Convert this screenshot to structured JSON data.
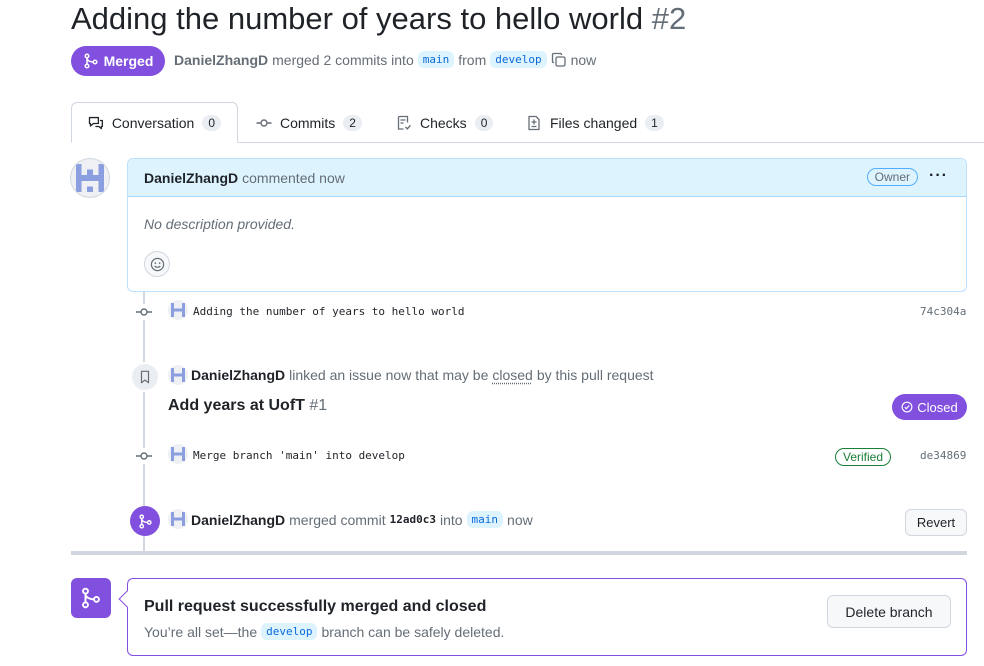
{
  "pr": {
    "title": "Adding the number of years to hello world",
    "number": "#2",
    "status": "Merged",
    "author": "DanielZhangD",
    "merged_text": "merged 2 commits into",
    "base_branch": "main",
    "from_text": "from",
    "head_branch": "develop",
    "time": "now"
  },
  "tabs": [
    {
      "label": "Conversation",
      "count": "0"
    },
    {
      "label": "Commits",
      "count": "2"
    },
    {
      "label": "Checks",
      "count": "0"
    },
    {
      "label": "Files changed",
      "count": "1"
    }
  ],
  "comment": {
    "author": "DanielZhangD",
    "action": "commented now",
    "role": "Owner",
    "body": "No description provided."
  },
  "timeline": {
    "commit1": {
      "message": "Adding the number of years to hello world",
      "sha": "74c304a"
    },
    "linked": {
      "author": "DanielZhangD",
      "text_pre": "linked an issue now that may be",
      "text_closed": "closed",
      "text_post": "by this pull request",
      "issue_title": "Add years at UofT",
      "issue_number": "#1",
      "issue_status": "Closed"
    },
    "commit2": {
      "message": "Merge branch 'main' into develop",
      "verified": "Verified",
      "sha": "de34869"
    },
    "merge_event": {
      "author": "DanielZhangD",
      "text": "merged commit",
      "sha": "12ad0c3",
      "into": "into",
      "branch": "main",
      "time": "now",
      "revert_label": "Revert"
    }
  },
  "merge_box": {
    "title": "Pull request successfully merged and closed",
    "sub_pre": "You’re all set—the",
    "branch": "develop",
    "sub_post": "branch can be safely deleted.",
    "delete_label": "Delete branch"
  },
  "colors": {
    "merged_purple": "#8250df",
    "link_blue": "#0969da",
    "verified_green": "#1a7f37"
  }
}
